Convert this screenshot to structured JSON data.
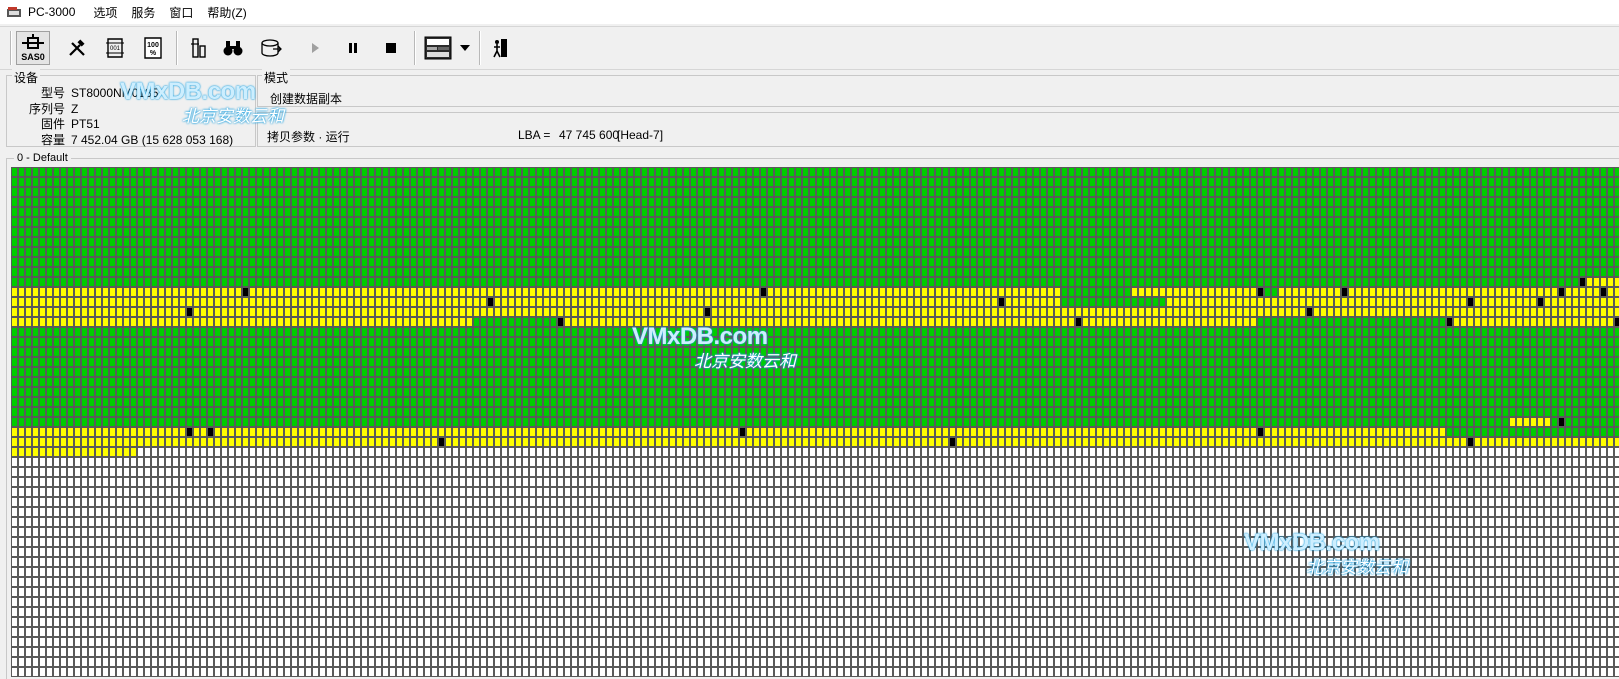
{
  "app": {
    "title": "PC-3000"
  },
  "menu": [
    {
      "label": "选项"
    },
    {
      "label": "服务"
    },
    {
      "label": "窗口"
    },
    {
      "label": "帮助(Z)"
    }
  ],
  "toolbar": {
    "sas_label": "SAS0"
  },
  "device": {
    "section_title": "设备",
    "model_label": "型号",
    "model_value": "ST8000NM0185",
    "serial_label": "序列号",
    "serial_value": "Z",
    "firmware_label": "固件",
    "firmware_value": "PT51",
    "capacity_label": "容量",
    "capacity_value": "7 452.04 GB (15 628 053 168)"
  },
  "mode": {
    "section_title": "模式",
    "value": "创建数据副本",
    "copy_params": "拷贝参数 · 运行",
    "lba_label": "LBA =",
    "lba_value": "47 745 600",
    "head": "[Head-7]"
  },
  "map": {
    "title": "0 - Default",
    "colors": {
      "read_ok": "#00cc00",
      "slow": "#ffff00",
      "bad": "#000000",
      "unread": "#ffffff",
      "border": "#5a5a5a"
    }
  },
  "watermarks": [
    {
      "en": "VMxDB.com",
      "cn": "北京安数云和"
    },
    {
      "en": "VMxDB.com",
      "cn": "北京安数云和"
    },
    {
      "en": "VMxDB.com",
      "cn": "北京安数云和"
    }
  ]
}
